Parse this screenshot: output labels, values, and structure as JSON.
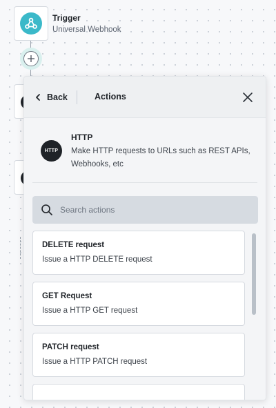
{
  "canvas": {
    "trigger": {
      "title": "Trigger",
      "subtitle": "Universal Webhook",
      "icon": "webhook-icon",
      "color": "#3bb9c9"
    },
    "add_step_icon": "plus-icon"
  },
  "panel": {
    "back_label": "Back",
    "title": "Actions",
    "close_icon": "close-icon",
    "app": {
      "logo_text": "HTTP",
      "name": "HTTP",
      "description": "Make HTTP requests to URLs such as REST APIs, Webhooks, etc"
    },
    "search": {
      "placeholder": "Search actions",
      "value": ""
    },
    "actions": [
      {
        "title": "DELETE request",
        "description": "Issue a HTTP DELETE request"
      },
      {
        "title": "GET Request",
        "description": "Issue a HTTP GET request"
      },
      {
        "title": "PATCH request",
        "description": "Issue a HTTP PATCH request"
      },
      {
        "title": "",
        "description": ""
      }
    ]
  }
}
